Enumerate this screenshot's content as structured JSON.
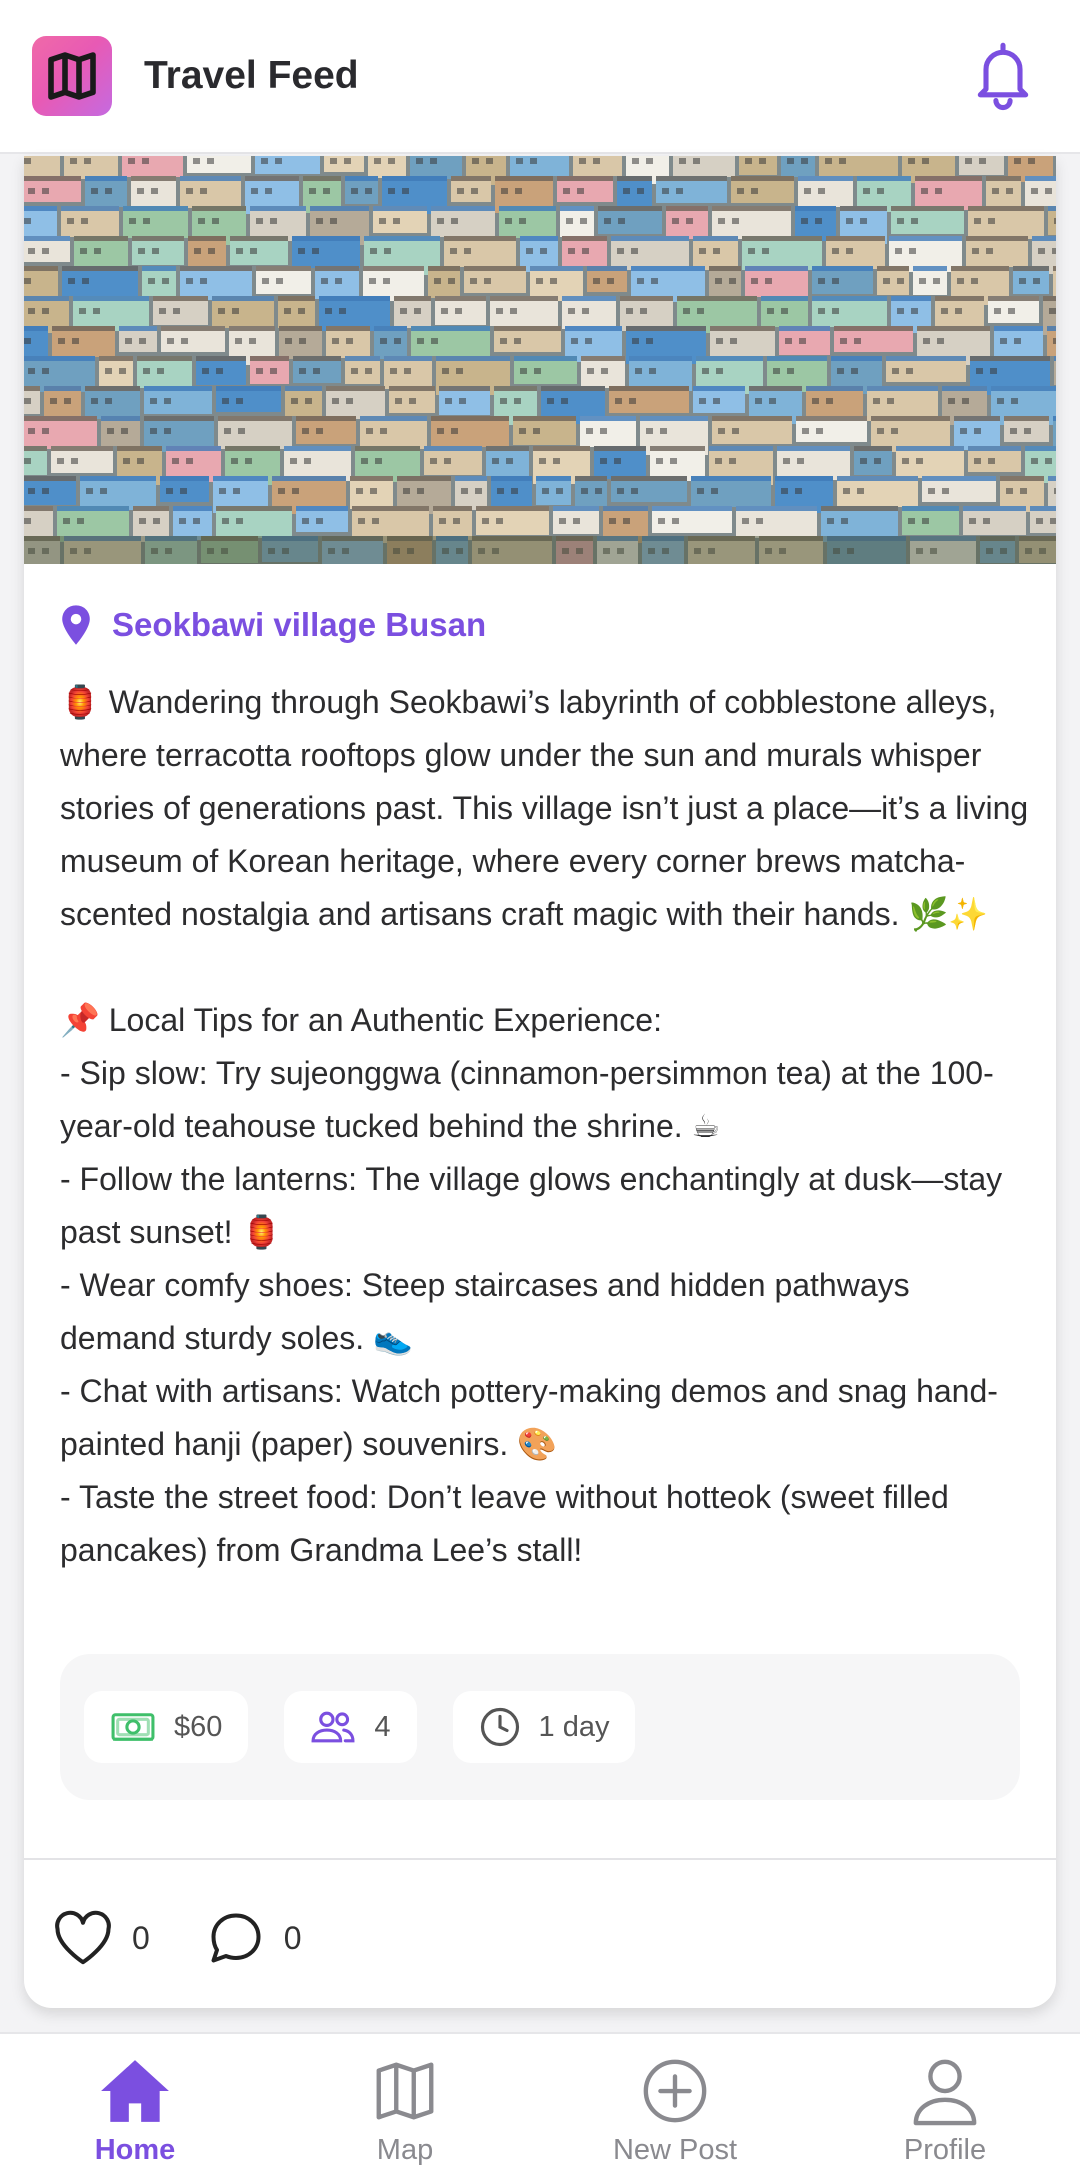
{
  "header": {
    "title": "Travel Feed",
    "logo_icon": "map-icon",
    "notification_icon": "bell-icon"
  },
  "post": {
    "image_alt": "colorful hillside houses",
    "location": "Seokbawi village Busan",
    "body": "🏮 Wandering through Seokbawi’s labyrinth of cobblestone alleys, where terracotta rooftops glow under the sun and murals whisper stories of generations past. This village isn’t just a place—it’s a living museum of Korean heritage, where every corner brews matcha-scented nostalgia and artisans craft magic with their hands. 🌿✨\n\n📌 Local Tips for an Authentic Experience:\n- Sip slow: Try sujeonggwa (cinnamon-persimmon tea) at the 100-year-old teahouse tucked behind the shrine. ☕\n- Follow the lanterns: The village glows enchantingly at dusk—stay past sunset! 🏮\n- Wear comfy shoes: Steep staircases and hidden pathways demand sturdy soles. 👟\n- Chat with artisans: Watch pottery-making demos and snag hand-painted hanji (paper) souvenirs. 🎨\n- Taste the street food: Don’t leave without hotteok (sweet filled pancakes) from Grandma Lee’s stall!",
    "stats": {
      "cost": "$60",
      "people": "4",
      "duration": "1 day"
    },
    "likes": "0",
    "comments": "0"
  },
  "nav": {
    "items": [
      {
        "label": "Home",
        "icon": "home-icon",
        "active": true
      },
      {
        "label": "Map",
        "icon": "map-icon",
        "active": false
      },
      {
        "label": "New Post",
        "icon": "plus-circle-icon",
        "active": false
      },
      {
        "label": "Profile",
        "icon": "user-icon",
        "active": false
      }
    ]
  },
  "colors": {
    "accent": "#7b4fe0",
    "money_green": "#3fbf6a"
  }
}
